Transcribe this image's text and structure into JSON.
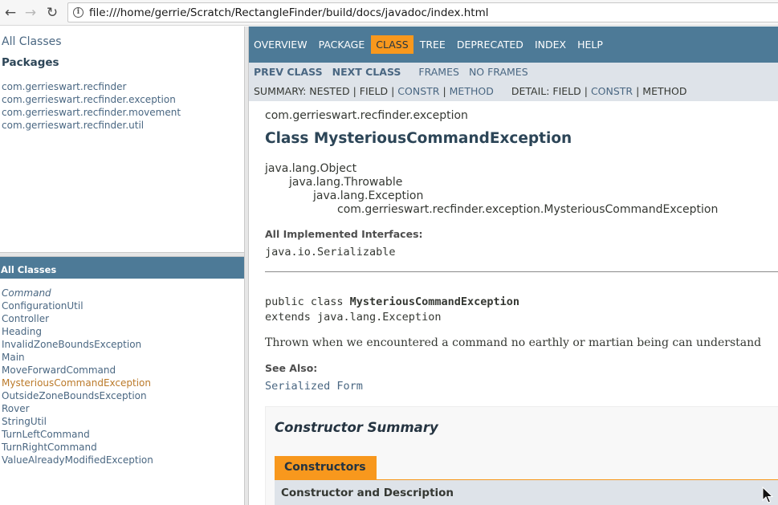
{
  "browser": {
    "url": "file:///home/gerrie/Scratch/RectangleFinder/build/docs/javadoc/index.html",
    "icons": {
      "back": "back-arrow-icon",
      "forward": "forward-arrow-icon",
      "reload": "reload-icon",
      "info": "page-info-icon"
    }
  },
  "package_frame": {
    "all_classes": "All Classes",
    "title": "Packages",
    "packages": [
      "com.gerrieswart.recfinder",
      "com.gerrieswart.recfinder.exception",
      "com.gerrieswart.recfinder.movement",
      "com.gerrieswart.recfinder.util"
    ]
  },
  "class_frame": {
    "title": "All Classes",
    "classes": [
      "Command",
      "ConfigurationUtil",
      "Controller",
      "Heading",
      "InvalidZoneBoundsException",
      "Main",
      "MoveForwardCommand",
      "MysteriousCommandException",
      "OutsideZoneBoundsException",
      "Rover",
      "StringUtil",
      "TurnLeftCommand",
      "TurnRightCommand",
      "ValueAlreadyModifiedException"
    ],
    "italic_index": 0,
    "visited_index": 7
  },
  "nav": {
    "items": [
      "Overview",
      "Package",
      "Class",
      "Tree",
      "Deprecated",
      "Index",
      "Help"
    ],
    "active": "Class",
    "prev_class": "Prev Class",
    "next_class": "Next Class",
    "frames": "Frames",
    "no_frames": "No Frames",
    "summary_prefix": "SUMMARY: NESTED | FIELD | ",
    "summary_constr": "CONSTR",
    "summary_sep": " | ",
    "summary_method": "METHOD",
    "detail_prefix": "DETAIL: FIELD | ",
    "detail_constr": "CONSTR",
    "detail_sep": " | METHOD"
  },
  "content": {
    "package": "com.gerrieswart.recfinder.exception",
    "class_title": "Class MysteriousCommandException",
    "inheritance": [
      "java.lang.Object",
      "java.lang.Throwable",
      "java.lang.Exception",
      "com.gerrieswart.recfinder.exception.MysteriousCommandException"
    ],
    "implemented_label": "All Implemented Interfaces:",
    "implemented_value": "java.io.Serializable",
    "decl_prefix": "public class ",
    "decl_name": "MysteriousCommandException",
    "decl_extends": "extends java.lang.Exception",
    "description": "Thrown when we encountered a command no earthly or martian being can understand",
    "see_also_label": "See Also:",
    "see_also_value": "Serialized Form",
    "constructor_summary": "Constructor Summary",
    "constructors_tab": "Constructors",
    "table_header": "Constructor and Description"
  },
  "colors": {
    "header_blue": "#4d7a97",
    "active_orange": "#f8981d",
    "subnav_gray": "#dee3e9",
    "link": "#4a6782",
    "visited": "#bb7a2a"
  }
}
